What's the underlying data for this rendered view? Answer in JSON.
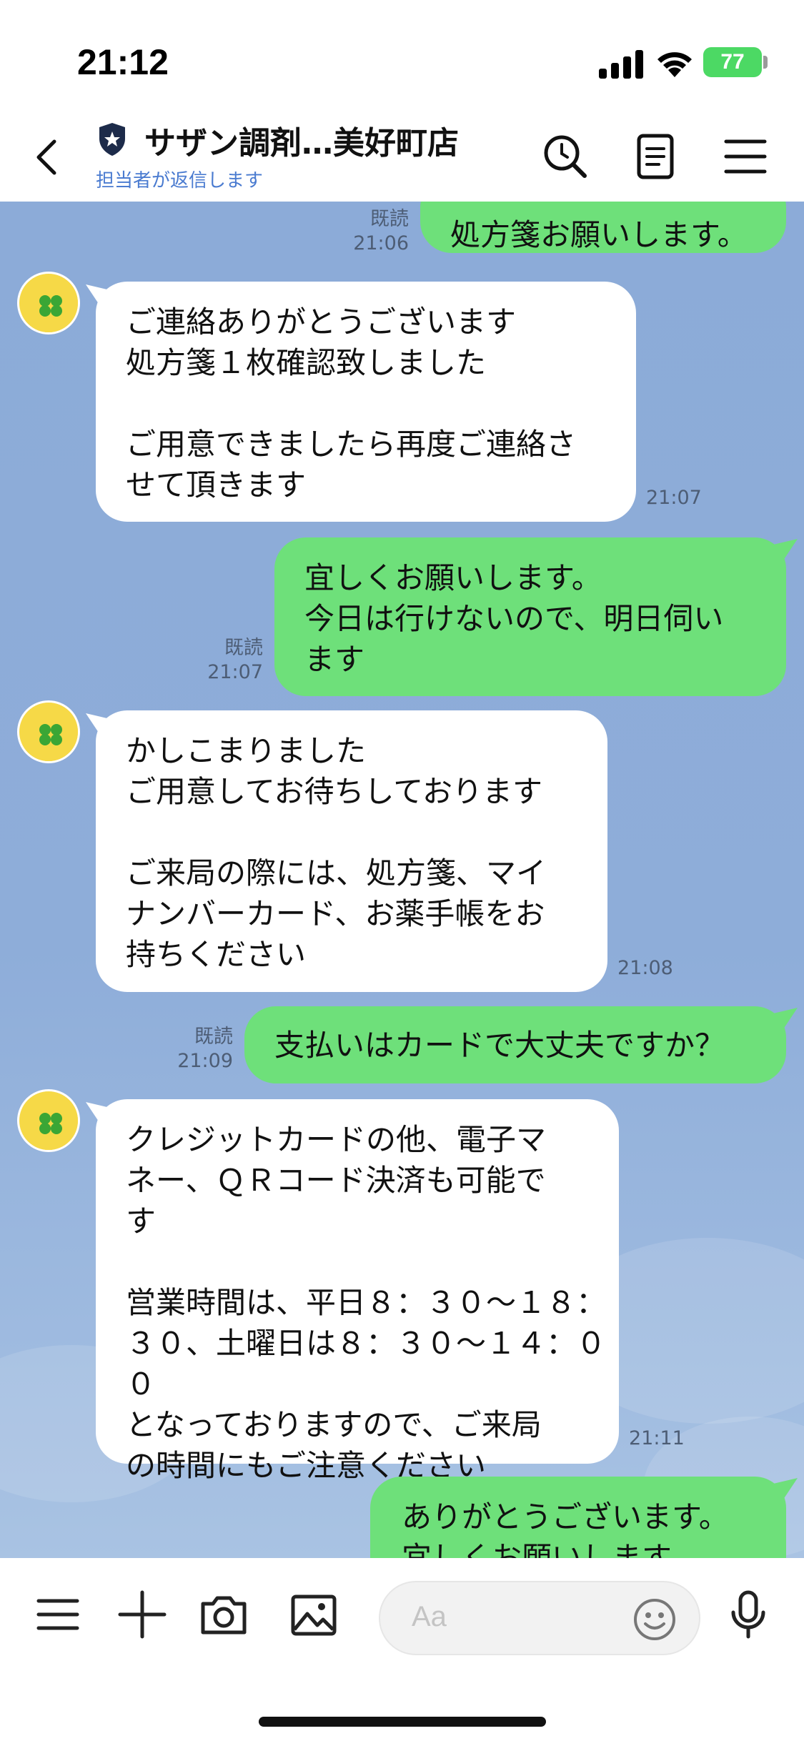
{
  "status_bar": {
    "time": "21:12",
    "battery": "77"
  },
  "header": {
    "title": "サザン調剤…美好町店",
    "subtitle": "担当者が返信します"
  },
  "messages": [
    {
      "side": "out",
      "text": "処方箋お願いします。",
      "read": "既読",
      "time": "21:06"
    },
    {
      "side": "in",
      "text": "ご連絡ありがとうございます\n処方箋１枚確認致しました\n\nご用意できましたら再度ご連絡さ\nせて頂きます",
      "time": "21:07"
    },
    {
      "side": "out",
      "text": "宜しくお願いします。\n今日は行けないので、明日伺い\nます",
      "read": "既読",
      "time": "21:07"
    },
    {
      "side": "in",
      "text": "かしこまりました\nご用意してお待ちしております\n\nご来局の際には、処方箋、マイ\nナンバーカード、お薬手帳をお\n持ちください",
      "time": "21:08"
    },
    {
      "side": "out",
      "text": "支払いはカードで大丈夫ですか？",
      "read": "既読",
      "time": "21:09"
    },
    {
      "side": "in",
      "text": "クレジットカードの他、電子マ\nネー、ＱＲコード決済も可能で\nす\n\n営業時間は、平日８：３０～１８：\n３０、土曜日は８：３０～１４：００\nとなっておりますので、ご来局\nの時間にもご注意ください",
      "time": "21:11"
    },
    {
      "side": "out",
      "text": "ありがとうございます。\n宜しくお願いします",
      "read": "",
      "time": ""
    }
  ],
  "input": {
    "placeholder": "Aa"
  },
  "icons": {
    "back": "chevron-left-icon",
    "verified": "shield-star-icon",
    "search": "search-icon",
    "notes": "note-icon",
    "menu": "menu-icon",
    "keyboard_menu": "menu-icon",
    "add": "plus-icon",
    "camera": "camera-icon",
    "image": "image-icon",
    "emoji": "emoji-icon",
    "mic": "microphone-icon"
  },
  "colors": {
    "chat_background": "#8cabd8",
    "outgoing_bubble": "#6ee07a",
    "incoming_bubble": "#ffffff",
    "subtitle_link": "#4a7bd0",
    "battery": "#4cd964"
  }
}
